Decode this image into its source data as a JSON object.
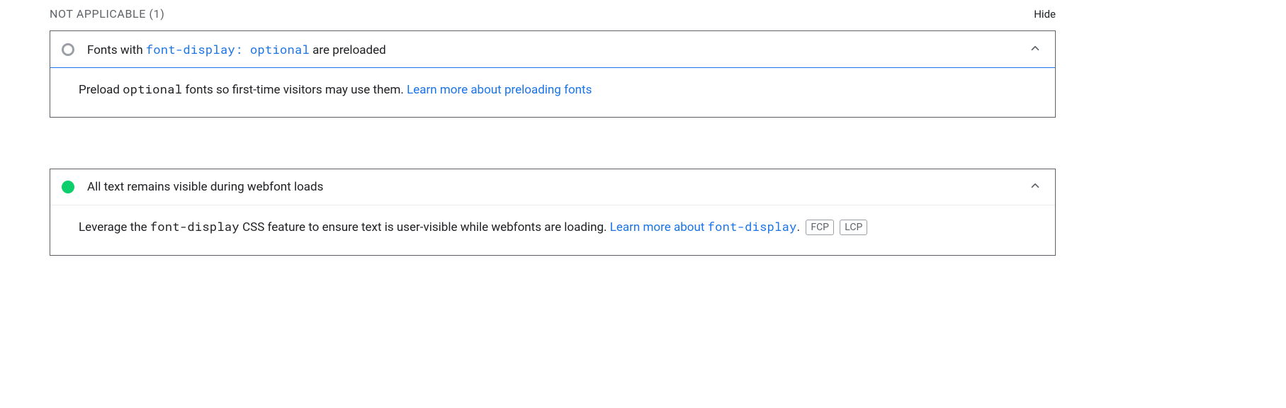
{
  "section": {
    "title_text": "NOT APPLICABLE",
    "count_text": "(1)",
    "hide_label": "Hide"
  },
  "audits": {
    "na": {
      "title_pre": "Fonts with ",
      "title_code": "font-display: optional",
      "title_post": " are preloaded",
      "body_pre": "Preload ",
      "body_code": "optional",
      "body_post": " fonts so first-time visitors may use them. ",
      "link_text": "Learn more about preloading fonts"
    },
    "pass": {
      "title": "All text remains visible during webfont loads",
      "body_pre": "Leverage the ",
      "body_code": "font-display",
      "body_post": " CSS feature to ensure text is user-visible while webfonts are loading. ",
      "link_pre": "Learn more about ",
      "link_code": "font-display",
      "dot": ".",
      "tag1": "FCP",
      "tag2": "LCP"
    }
  }
}
